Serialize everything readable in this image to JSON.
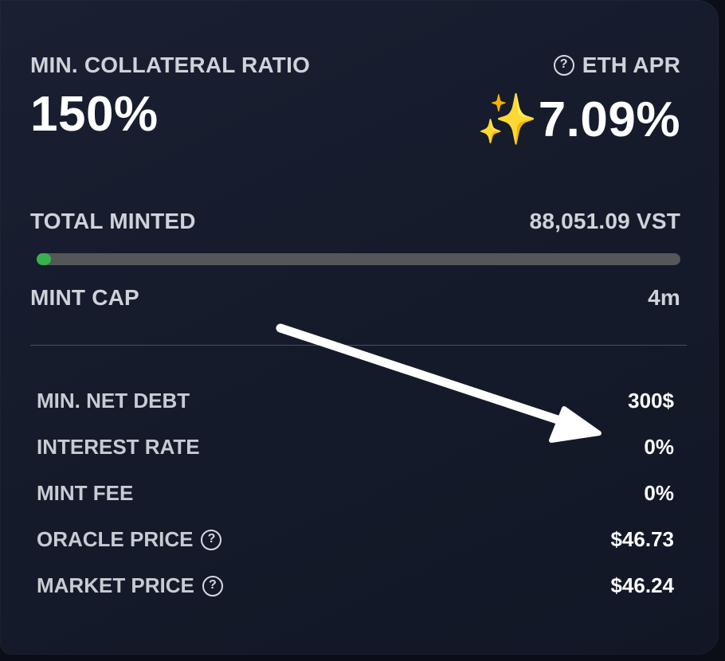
{
  "header": {
    "min_collateral_label": "MIN. COLLATERAL RATIO",
    "min_collateral_value": "150%",
    "eth_apr_label": "ETH APR",
    "eth_apr_value": "✨7.09%"
  },
  "minted": {
    "total_label": "TOTAL MINTED",
    "total_value": "88,051.09 VST",
    "progress_fraction": 0.022,
    "cap_label": "MINT CAP",
    "cap_value": "4m"
  },
  "details": [
    {
      "label": "MIN. NET DEBT",
      "value": "300$",
      "help": false
    },
    {
      "label": "INTEREST RATE",
      "value": "0%",
      "help": false
    },
    {
      "label": "MINT FEE",
      "value": "0%",
      "help": false
    },
    {
      "label": "ORACLE PRICE",
      "value": "$46.73",
      "help": true
    },
    {
      "label": "MARKET PRICE",
      "value": "$46.24",
      "help": true
    }
  ],
  "icons": {
    "help": "question-circle-icon",
    "annotation": "arrow-annotation"
  },
  "colors": {
    "progress_fill": "#37b24d",
    "progress_track": "#545658",
    "card_bg": "#171c2c"
  }
}
